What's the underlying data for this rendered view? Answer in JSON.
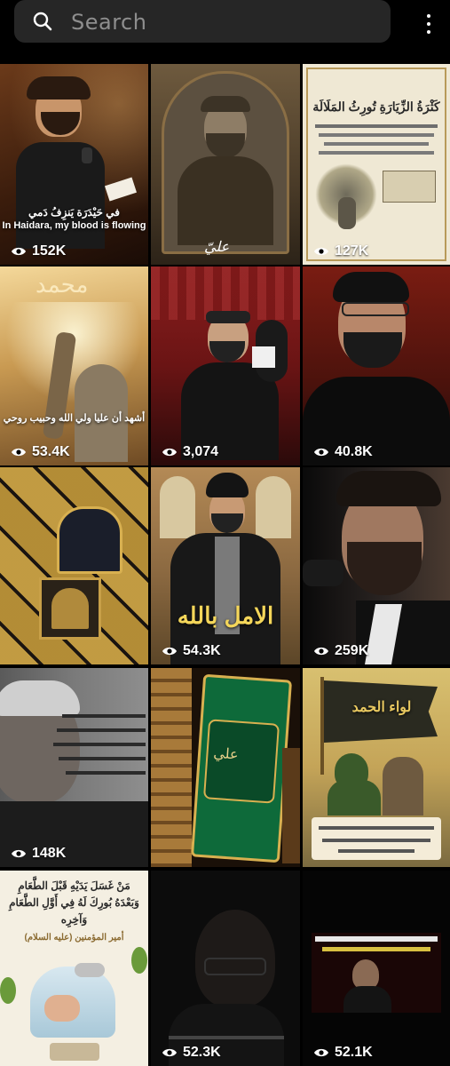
{
  "search": {
    "placeholder": "Search"
  },
  "tiles": [
    {
      "views": "152K",
      "caption_ar": "في حَيْدَرَة يَنزِفُ دَمي",
      "caption_en": "In Haidara, my blood is flowing"
    },
    {
      "views": ""
    },
    {
      "views": "127K",
      "title_ar": "كَثْرَةُ الزِّيَارَةِ تُورِثُ المَلَالَة"
    },
    {
      "views": "53.4K",
      "caption_ar": "أشهد أن عليا ولي الله وحبيب روحي"
    },
    {
      "views": "3,074"
    },
    {
      "views": "40.8K"
    },
    {
      "views": ""
    },
    {
      "views": "54.3K",
      "title_ar": "الامل بالله"
    },
    {
      "views": "259K"
    },
    {
      "views": "148K"
    },
    {
      "views": ""
    },
    {
      "views": "",
      "banner_ar": "لواء الحمد"
    },
    {
      "views": "",
      "quote_ar": "مَنْ غَسَلَ يَدَيْهِ قَبْلَ الطَّعَامِ وَبَعْدَهُ بُورِكَ لَهُ فِي أَوَّلِ الطَّعَامِ وَآخِرِه",
      "source_ar": "أمير المؤمنين (عليه السلام)"
    },
    {
      "views": "52.3K"
    },
    {
      "views": "52.1K"
    }
  ],
  "colors": {
    "background": "#000000",
    "search_bg": "#262626",
    "placeholder": "#8e8e8e"
  }
}
